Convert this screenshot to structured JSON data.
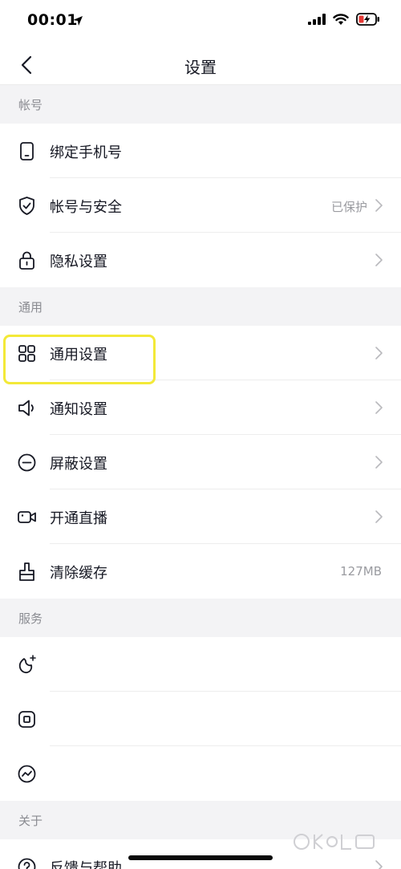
{
  "status": {
    "time": "00:01"
  },
  "nav": {
    "title": "设置"
  },
  "sections": {
    "account": "帐号",
    "general": "通用",
    "service": "服务",
    "about": "关于"
  },
  "rows": {
    "bind_phone": {
      "label": "绑定手机号"
    },
    "account_security": {
      "label": "帐号与安全",
      "value": "已保护"
    },
    "privacy": {
      "label": "隐私设置"
    },
    "general_settings": {
      "label": "通用设置"
    },
    "notification": {
      "label": "通知设置"
    },
    "block": {
      "label": "屏蔽设置"
    },
    "live": {
      "label": "开通直播"
    },
    "clear_cache": {
      "label": "清除缓存",
      "value": "127MB"
    },
    "feedback": {
      "label": "反馈与帮助"
    }
  },
  "icons": {
    "bind_phone": "phone-icon",
    "account_security": "shield-check-icon",
    "privacy": "lock-icon",
    "general_settings": "grid-icon",
    "notification": "speaker-icon",
    "block": "minus-circle-icon",
    "live": "video-camera-icon",
    "clear_cache": "brush-icon",
    "service_1": "sparkle-icon",
    "service_2": "square-box-icon",
    "service_3": "trend-circle-icon",
    "feedback": "question-circle-icon"
  },
  "colors": {
    "highlight": "#f3e938",
    "text": "#161823",
    "secondary": "#9a9ba0"
  }
}
